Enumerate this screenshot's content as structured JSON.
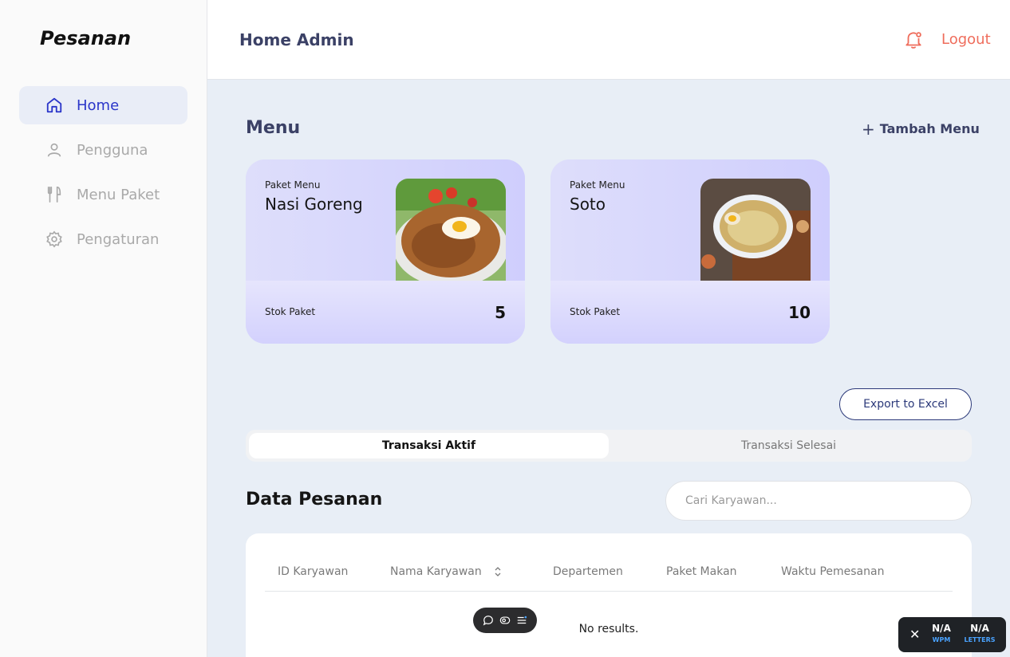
{
  "sidebar": {
    "brand": "Pesanan",
    "items": [
      {
        "label": "Home",
        "icon": "home-icon",
        "active": true
      },
      {
        "label": "Pengguna",
        "icon": "user-icon",
        "active": false
      },
      {
        "label": "Menu Paket",
        "icon": "utensils-icon",
        "active": false
      },
      {
        "label": "Pengaturan",
        "icon": "gear-icon",
        "active": false
      }
    ]
  },
  "header": {
    "title": "Home Admin",
    "logout_label": "Logout",
    "accent_color": "#ef6d5c"
  },
  "menu": {
    "title": "Menu",
    "add_label": "Tambah Menu",
    "cards": [
      {
        "kicker": "Paket Menu",
        "name": "Nasi Goreng",
        "stock_label": "Stok Paket",
        "stock": "5"
      },
      {
        "kicker": "Paket Menu",
        "name": "Soto",
        "stock_label": "Stok Paket",
        "stock": "10"
      }
    ]
  },
  "export_label": "Export to Excel",
  "tabs": [
    {
      "label": "Transaksi Aktif",
      "active": true
    },
    {
      "label": "Transaksi Selesai",
      "active": false
    }
  ],
  "orders": {
    "title": "Data Pesanan",
    "search_placeholder": "Cari Karyawan...",
    "columns": [
      "ID Karyawan",
      "Nama Karyawan",
      "Departemen",
      "Paket Makan",
      "Waktu Pemesanan"
    ],
    "empty_text": "No results."
  },
  "widget": {
    "wpm_value": "N/A",
    "wpm_label": "WPM",
    "letters_value": "N/A",
    "letters_label": "LETTERS"
  }
}
